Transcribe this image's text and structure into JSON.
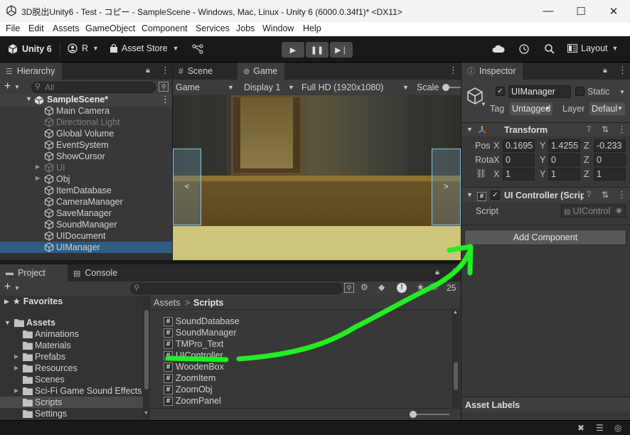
{
  "titlebar": {
    "title": "3D脱出Unity6 - Test - コピー - SampleScene - Windows, Mac, Linux - Unity 6 (6000.0.34f1)* <DX11>",
    "minimize": "—",
    "maximize": "☐",
    "close": "✕"
  },
  "menu": [
    "File",
    "Edit",
    "Assets",
    "GameObject",
    "Component",
    "Services",
    "Jobs",
    "Window",
    "Help"
  ],
  "toolbar": {
    "unity_label": "Unity 6",
    "account_label": "R",
    "asset_store_label": "Asset Store",
    "layout_label": "Layout",
    "play_icon": "▶",
    "pause_icon": "❚❚",
    "step_icon": "▶❘"
  },
  "hierarchy": {
    "tab_label": "Hierarchy",
    "search_placeholder": "All",
    "scene_name": "SampleScene*",
    "items": [
      {
        "label": "Main Camera",
        "muted": false
      },
      {
        "label": "Directional Light",
        "muted": true
      },
      {
        "label": "Global Volume",
        "muted": false
      },
      {
        "label": "EventSystem",
        "muted": false
      },
      {
        "label": "ShowCursor",
        "muted": false
      },
      {
        "label": "UI",
        "muted": true
      },
      {
        "label": "Obj",
        "muted": false
      },
      {
        "label": "ItemDatabase",
        "muted": false
      },
      {
        "label": "CameraManager",
        "muted": false
      },
      {
        "label": "SaveManager",
        "muted": false
      },
      {
        "label": "SoundManager",
        "muted": false
      },
      {
        "label": "UIDocument",
        "muted": false
      },
      {
        "label": "UIManager",
        "muted": false
      }
    ]
  },
  "view": {
    "scene_tab": "Scene",
    "game_tab": "Game",
    "game_dropdown": "Game",
    "display_dropdown": "Display 1",
    "resolution_dropdown": "Full HD (1920x1080)",
    "scale_label": "Scale",
    "left_arrow": "<",
    "right_arrow": ">"
  },
  "project": {
    "project_tab": "Project",
    "console_tab": "Console",
    "badge_count": "25",
    "favorites_label": "Favorites",
    "assets_label": "Assets",
    "folders": [
      "Animations",
      "Materials",
      "Prefabs",
      "Resources",
      "Scenes",
      "Sci-Fi Game Sound Effects",
      "Scripts",
      "Settings"
    ],
    "breadcrumb_root": "Assets",
    "breadcrumb_sep": ">",
    "breadcrumb_current": "Scripts",
    "files": [
      "SoundDatabase",
      "SoundManager",
      "TMPro_Text",
      "UIController",
      "WoodenBox",
      "ZoomItem",
      "ZoomObj",
      "ZoomPanel"
    ]
  },
  "inspector": {
    "tab_label": "Inspector",
    "object_name": "UIManager",
    "static_label": "Static",
    "tag_label": "Tag",
    "tag_value": "Untagged",
    "layer_label": "Layer",
    "layer_value": "Default",
    "transform_header": "Transform",
    "pos_label": "Pos",
    "rot_label": "Rota",
    "pos": {
      "x": "0.1695",
      "y": "1.4255",
      "z": "-0.233"
    },
    "rot": {
      "x": "0",
      "y": "0",
      "z": "0"
    },
    "scale": {
      "x": "1",
      "y": "1",
      "z": "1"
    },
    "axis_x": "X",
    "axis_y": "Y",
    "axis_z": "Z",
    "component_header": "UI Controller (Script)",
    "script_label": "Script",
    "script_value": "UIControl",
    "add_component": "Add Component",
    "asset_labels": "Asset Labels"
  },
  "colors": {
    "annotation_green": "#22ee22",
    "selection_blue": "#2c5d87",
    "game_floor": "#cdc67a"
  }
}
